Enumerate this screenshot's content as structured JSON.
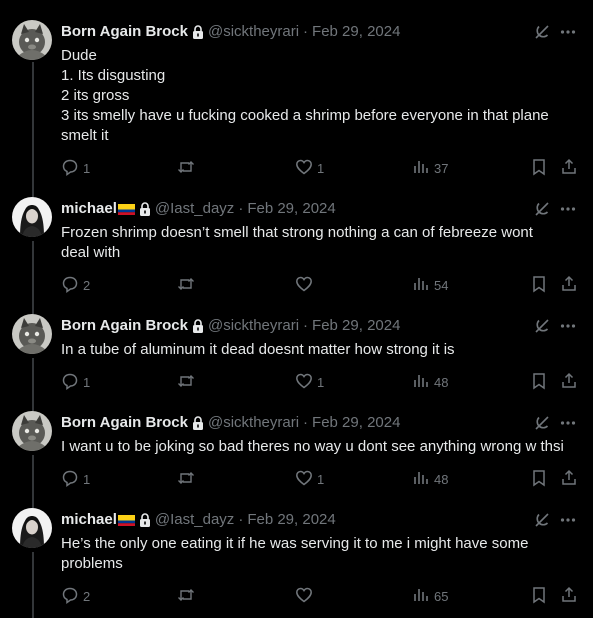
{
  "tweets": [
    {
      "name": "Born Again Brock",
      "handle": "@sicktheyrari",
      "separator": "·",
      "date": "Feb 29, 2024",
      "lines": [
        "Dude",
        "1. Its disgusting",
        "2 its gross",
        "3 its smelly have u fucking cooked a shrimp before everyone in that plane",
        "smelt it"
      ],
      "replies": "1",
      "reposts": "",
      "likes": "1",
      "views": "37",
      "avatar": "cat"
    },
    {
      "name": "michael",
      "handle": "@Iast_dayz",
      "separator": "·",
      "date": "Feb 29, 2024",
      "lines": [
        "Frozen shrimp doesn’t smell that strong nothing a can of febreeze wont",
        "deal with"
      ],
      "replies": "2",
      "reposts": "",
      "likes": "",
      "views": "54",
      "avatar": "person"
    },
    {
      "name": "Born Again Brock",
      "handle": "@sicktheyrari",
      "separator": "·",
      "date": "Feb 29, 2024",
      "lines": [
        "In a tube of aluminum it dead doesnt matter how strong it is"
      ],
      "replies": "1",
      "reposts": "",
      "likes": "1",
      "views": "48",
      "avatar": "cat"
    },
    {
      "name": "Born Again Brock",
      "handle": "@sicktheyrari",
      "separator": "·",
      "date": "Feb 29, 2024",
      "lines": [
        "I want u to be joking so bad theres no way u dont see anything wrong w thsi"
      ],
      "replies": "1",
      "reposts": "",
      "likes": "1",
      "views": "48",
      "avatar": "cat"
    },
    {
      "name": "michael",
      "handle": "@Iast_dayz",
      "separator": "·",
      "date": "Feb 29, 2024",
      "lines": [
        "He’s the only one eating it if he was serving it to me i might have some",
        "problems"
      ],
      "replies": "2",
      "reposts": "",
      "likes": "",
      "views": "65",
      "avatar": "person"
    }
  ],
  "icons": {
    "lock": "lock-icon",
    "flag": "colombia-flag-icon",
    "grok": "grok-icon",
    "more": "more-icon",
    "reply": "reply-icon",
    "repost": "repost-icon",
    "like": "like-icon",
    "views": "views-icon",
    "bookmark": "bookmark-icon",
    "share": "share-icon"
  },
  "colors": {
    "background": "#000000",
    "text": "#e7e9ea",
    "muted": "#71767b",
    "thread_line": "#333639"
  }
}
